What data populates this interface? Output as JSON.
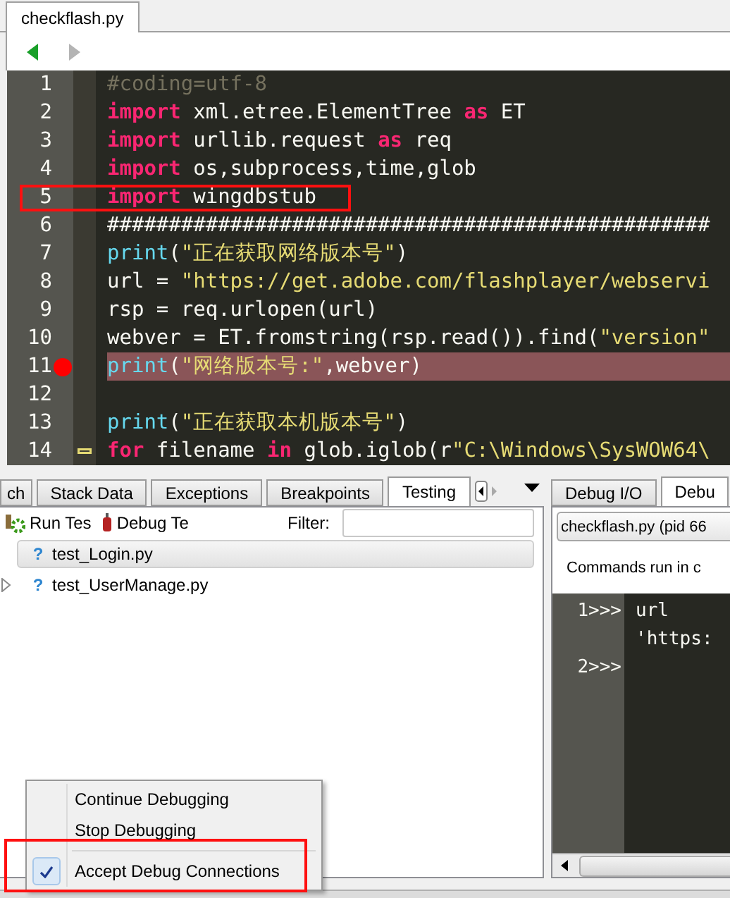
{
  "file_tab": {
    "label": "checkflash.py",
    "selected": true
  },
  "editor": {
    "lines": [
      {
        "number": "1",
        "breakpoint": false,
        "highlighted": false,
        "boxed": false,
        "folded": false,
        "tokens": [
          {
            "kind": "comment",
            "text": "#coding=utf-8"
          }
        ]
      },
      {
        "number": "2",
        "breakpoint": false,
        "highlighted": false,
        "boxed": false,
        "folded": false,
        "tokens": [
          {
            "kind": "keyword",
            "text": "import"
          },
          {
            "kind": "plain",
            "text": " xml.etree.ElementTree "
          },
          {
            "kind": "keyword",
            "text": "as"
          },
          {
            "kind": "plain",
            "text": " ET"
          }
        ]
      },
      {
        "number": "3",
        "breakpoint": false,
        "highlighted": false,
        "boxed": false,
        "folded": false,
        "tokens": [
          {
            "kind": "keyword",
            "text": "import"
          },
          {
            "kind": "plain",
            "text": " urllib.request "
          },
          {
            "kind": "keyword",
            "text": "as"
          },
          {
            "kind": "plain",
            "text": " req"
          }
        ]
      },
      {
        "number": "4",
        "breakpoint": false,
        "highlighted": false,
        "boxed": false,
        "folded": false,
        "tokens": [
          {
            "kind": "keyword",
            "text": "import"
          },
          {
            "kind": "plain",
            "text": " os,subprocess,time,glob"
          }
        ]
      },
      {
        "number": "5",
        "breakpoint": false,
        "highlighted": false,
        "boxed": true,
        "folded": false,
        "tokens": [
          {
            "kind": "keyword",
            "text": "import"
          },
          {
            "kind": "plain",
            "text": " wingdbstub"
          }
        ]
      },
      {
        "number": "6",
        "breakpoint": false,
        "highlighted": false,
        "boxed": false,
        "folded": false,
        "tokens": [
          {
            "kind": "plain",
            "text": "#################################################"
          }
        ]
      },
      {
        "number": "7",
        "breakpoint": false,
        "highlighted": false,
        "boxed": false,
        "folded": false,
        "tokens": [
          {
            "kind": "builtin",
            "text": "print"
          },
          {
            "kind": "plain",
            "text": "("
          },
          {
            "kind": "string",
            "text": "\"正在获取网络版本号\""
          },
          {
            "kind": "plain",
            "text": ")"
          }
        ]
      },
      {
        "number": "8",
        "breakpoint": false,
        "highlighted": false,
        "boxed": false,
        "folded": false,
        "tokens": [
          {
            "kind": "plain",
            "text": "url = "
          },
          {
            "kind": "string",
            "text": "\"https://get.adobe.com/flashplayer/webservi"
          }
        ]
      },
      {
        "number": "9",
        "breakpoint": false,
        "highlighted": false,
        "boxed": false,
        "folded": false,
        "tokens": [
          {
            "kind": "plain",
            "text": "rsp = req.urlopen(url)"
          }
        ]
      },
      {
        "number": "10",
        "breakpoint": false,
        "highlighted": false,
        "boxed": false,
        "folded": false,
        "tokens": [
          {
            "kind": "plain",
            "text": "webver = ET.fromstring(rsp.read()).find("
          },
          {
            "kind": "string",
            "text": "\"version\""
          }
        ]
      },
      {
        "number": "11",
        "breakpoint": true,
        "highlighted": true,
        "boxed": false,
        "folded": false,
        "tokens": [
          {
            "kind": "builtin",
            "text": "print"
          },
          {
            "kind": "plain",
            "text": "("
          },
          {
            "kind": "string",
            "text": "\"网络版本号:\""
          },
          {
            "kind": "plain",
            "text": ",webver)"
          }
        ]
      },
      {
        "number": "12",
        "breakpoint": false,
        "highlighted": false,
        "boxed": false,
        "folded": false
      },
      {
        "number": "13",
        "breakpoint": false,
        "highlighted": false,
        "boxed": false,
        "folded": false,
        "tokens": [
          {
            "kind": "builtin",
            "text": "print"
          },
          {
            "kind": "plain",
            "text": "("
          },
          {
            "kind": "string",
            "text": "\"正在获取本机版本号\""
          },
          {
            "kind": "plain",
            "text": ")"
          }
        ]
      },
      {
        "number": "14",
        "breakpoint": false,
        "highlighted": false,
        "boxed": false,
        "folded": true,
        "tokens": [
          {
            "kind": "keyword",
            "text": "for"
          },
          {
            "kind": "plain",
            "text": " filename "
          },
          {
            "kind": "keyword",
            "text": "in"
          },
          {
            "kind": "plain",
            "text": " glob.iglob(r"
          },
          {
            "kind": "string",
            "text": "\"C:\\Windows\\SysWOW64\\"
          }
        ]
      }
    ]
  },
  "left_panel": {
    "tabs": [
      {
        "label": "ch",
        "selected": false
      },
      {
        "label": "Stack Data",
        "selected": false
      },
      {
        "label": "Exceptions",
        "selected": false
      },
      {
        "label": "Breakpoints",
        "selected": false
      },
      {
        "label": "Testing",
        "selected": true
      }
    ],
    "toolbar": {
      "run_label": "Run Tes",
      "debug_label": "Debug Te",
      "filter_label": "Filter:"
    },
    "tree": [
      {
        "status_glyph": "?",
        "name": "test_Login.py",
        "selected": true,
        "expandable": false
      },
      {
        "status_glyph": "?",
        "name": "test_UserManage.py",
        "selected": false,
        "expandable": true
      }
    ]
  },
  "right_panel": {
    "tabs": [
      {
        "label": "Debug I/O",
        "selected": false
      },
      {
        "label": "Debu",
        "selected": true
      }
    ],
    "process_select": "checkflash.py (pid 66",
    "info": "Commands run in c",
    "shell": [
      {
        "prompt": "1>>>",
        "lines": [
          "url",
          "'https:"
        ]
      },
      {
        "prompt": "2>>>"
      }
    ]
  },
  "context_menu": {
    "items": [
      {
        "kind": "item",
        "label": "Continue Debugging",
        "checked": false,
        "boxed": false
      },
      {
        "kind": "item",
        "label": "Stop Debugging",
        "checked": false,
        "boxed": false
      },
      {
        "kind": "separator"
      },
      {
        "kind": "item",
        "label": "Accept Debug Connections",
        "checked": true,
        "boxed": true
      }
    ]
  }
}
